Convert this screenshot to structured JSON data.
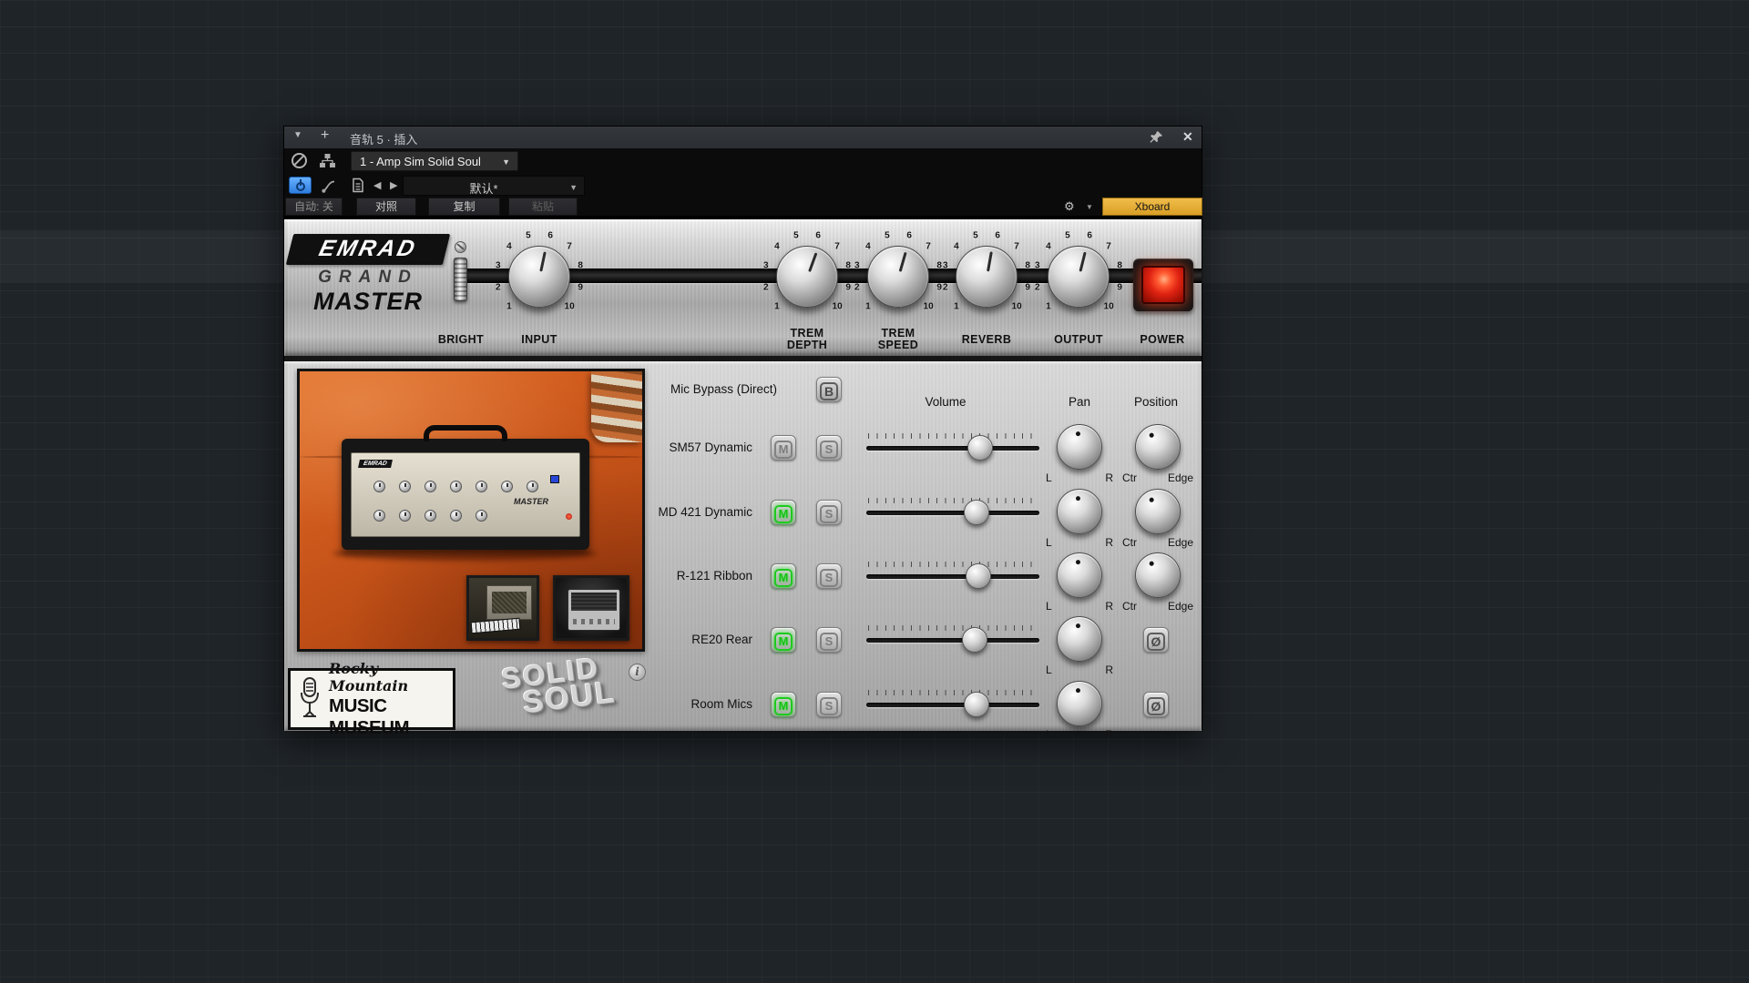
{
  "titlebar": {
    "caret": "▼",
    "plus": "+",
    "title": "音轨 5 · 插入",
    "close": "✕"
  },
  "plugin_bar": {
    "selector_value": "1 - Amp Sim Solid Soul",
    "caret": "▼"
  },
  "toolbar": {
    "preset_value": "默认*",
    "prev": "◀",
    "next": "▶",
    "caret": "▼",
    "gear": "⚙"
  },
  "actions": {
    "auto": "自动: 关",
    "compare": "对照",
    "copy": "复制",
    "paste": "粘贴",
    "xboard": "Xboard"
  },
  "amp": {
    "brand_top": "EMRAD",
    "brand_mid": "GRAND",
    "brand_bottom": "MASTER",
    "tick_numbers": [
      "1",
      "2",
      "3",
      "4",
      "5",
      "6",
      "7",
      "8",
      "9",
      "10"
    ],
    "bright_label": "BRIGHT",
    "power_label": "POWER",
    "knobs": [
      {
        "line1": "INPUT",
        "line2": ""
      },
      {
        "line1": "TREM",
        "line2": "DEPTH"
      },
      {
        "line1": "TREM",
        "line2": "SPEED"
      },
      {
        "line1": "REVERB",
        "line2": ""
      },
      {
        "line1": "OUTPUT",
        "line2": ""
      }
    ]
  },
  "mixer": {
    "bypass_label": "Mic Bypass (Direct)",
    "bypass_letter": "B",
    "mute_letter": "M",
    "solo_letter": "S",
    "phase_symbol": "Ø",
    "headers": {
      "volume": "Volume",
      "pan": "Pan",
      "position": "Position"
    },
    "pan_left": "L",
    "pan_right": "R",
    "pos_left": "Ctr",
    "pos_right": "Edge",
    "channels": [
      {
        "name": "SM57 Dynamic",
        "mute_on": false,
        "solo_on": false,
        "volume_pct": 73
      },
      {
        "name": "MD 421 Dynamic",
        "mute_on": true,
        "solo_on": false,
        "volume_pct": 71
      },
      {
        "name": "R-121 Ribbon",
        "mute_on": true,
        "solo_on": false,
        "volume_pct": 72
      },
      {
        "name": "RE20 Rear",
        "mute_on": true,
        "solo_on": false,
        "volume_pct": 70
      },
      {
        "name": "Room Mics",
        "mute_on": true,
        "solo_on": false,
        "volume_pct": 71
      }
    ]
  },
  "footer": {
    "museum_script": "Rocky Mountain",
    "museum_caps": "MUSIC MUSEUM",
    "logo_line1": "SOLID",
    "logo_line2": "SOUL",
    "info": "i"
  },
  "colors": {
    "xboard_yellow": "#e2ab33",
    "active_green": "#26e026",
    "power_button_blue": "#3d8de8",
    "power_lamp_red": "#e02312"
  }
}
